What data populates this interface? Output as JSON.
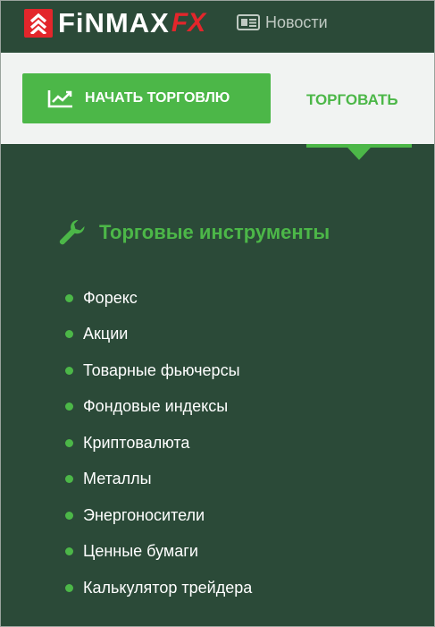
{
  "brand": {
    "logo_text": "FiNMAX",
    "logo_suffix": "FX",
    "accent": "#e3262b"
  },
  "topnav": {
    "news_label": "Новости",
    "news_icon": "newspaper-icon"
  },
  "actions": {
    "start_label": "НАЧАТЬ ТОРГОВЛЮ",
    "start_icon": "trending-chart-icon",
    "trade_tab_label": "ТОРГОВАТЬ"
  },
  "section": {
    "title": "Торговые инструменты",
    "icon": "wrench-icon",
    "items": [
      {
        "label": "Форекс"
      },
      {
        "label": "Акции"
      },
      {
        "label": "Товарные фьючерсы"
      },
      {
        "label": "Фондовые индексы"
      },
      {
        "label": "Криптовалюта"
      },
      {
        "label": "Металлы"
      },
      {
        "label": "Энергоносители"
      },
      {
        "label": "Ценные бумаги"
      },
      {
        "label": "Калькулятор трейдера"
      }
    ]
  },
  "colors": {
    "background": "#2b4a38",
    "green": "#4cb748",
    "band": "#f1f3f2"
  }
}
